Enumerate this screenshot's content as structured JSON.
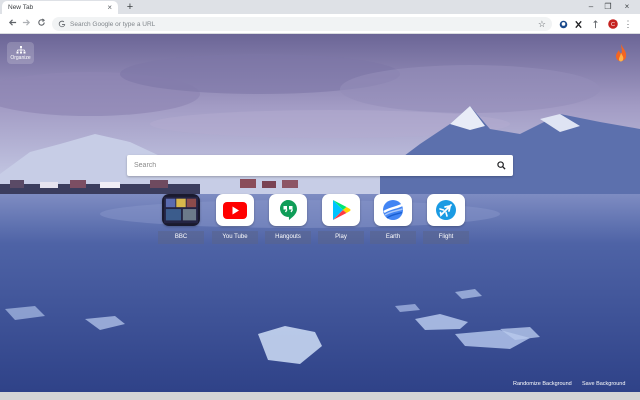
{
  "browser": {
    "tab_title": "New Tab",
    "tab_close": "×",
    "new_tab": "+",
    "window_controls": [
      "–",
      "❐",
      "×"
    ],
    "omnibox_placeholder": "Search Google or type a URL",
    "extensions": [
      "ghostery-icon",
      "x-icon",
      "tick-icon",
      "profile-avatar"
    ],
    "menu": "⋮"
  },
  "newtab": {
    "organize_label": "Organize",
    "search_placeholder": "Search",
    "shortcuts": [
      {
        "label": "BBC",
        "icon": "bbc-thumbnail-icon"
      },
      {
        "label": "You Tube",
        "icon": "youtube-icon"
      },
      {
        "label": "Hangouts",
        "icon": "hangouts-icon"
      },
      {
        "label": "Play",
        "icon": "google-play-icon"
      },
      {
        "label": "Earth",
        "icon": "google-earth-icon"
      },
      {
        "label": "Flight",
        "icon": "flight-icon"
      }
    ],
    "footer": {
      "randomize": "Randomize Background",
      "save": "Save Background"
    }
  },
  "colors": {
    "youtube_red": "#ff0000",
    "hangouts_green": "#0f9d58",
    "earth_blue": "#4285f4",
    "flight_blue": "#1a9be3",
    "flame_orange": "#f26522"
  }
}
